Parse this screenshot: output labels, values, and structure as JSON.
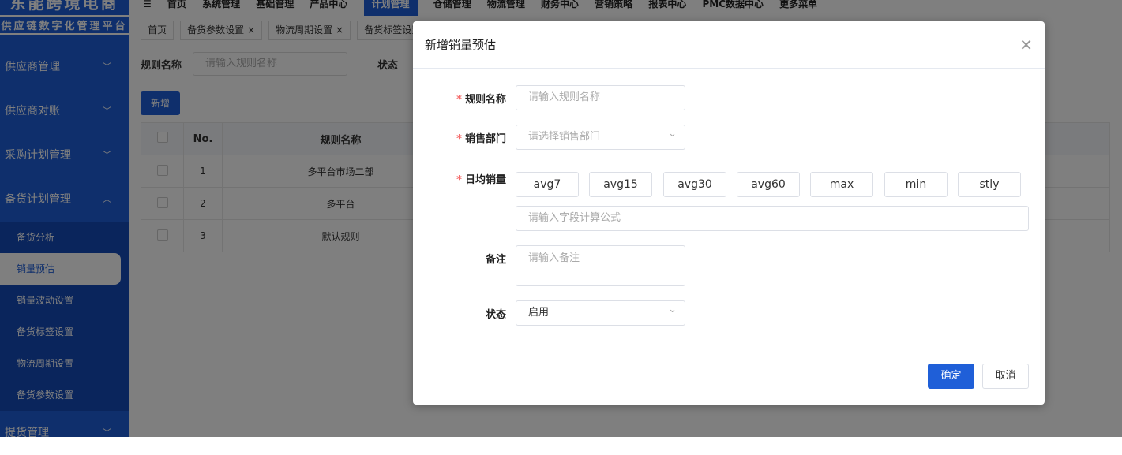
{
  "logo": {
    "line1": "东能跨境电商",
    "line2": "供应链数字化管理平台"
  },
  "topnav": [
    "首页",
    "系统管理",
    "基础管理",
    "产品中心",
    "计划管理",
    "仓储管理",
    "物流管理",
    "财务中心",
    "营销策略",
    "报表中心",
    "PMC数据中心",
    "更多菜单"
  ],
  "tabs": [
    "首页",
    "备货参数设置 ×",
    "物流周期设置 ×",
    "备货标签设置"
  ],
  "sidebar": {
    "items": [
      {
        "label": "供应商管理"
      },
      {
        "label": "供应商对账"
      },
      {
        "label": "采购计划管理"
      },
      {
        "label": "备货计划管理"
      }
    ],
    "sub": [
      "备货分析",
      "销量预估",
      "销量波动设置",
      "备货标签设置",
      "物流周期设置",
      "备货参数设置"
    ],
    "last": "提货管理"
  },
  "filter": {
    "name_label": "规则名称",
    "name_placeholder": "请输入规则名称",
    "status_label": "状态"
  },
  "new_button": "新增",
  "table": {
    "headers": [
      "No.",
      "规则名称"
    ],
    "rows": [
      [
        "1",
        "多平台市场二部"
      ],
      [
        "2",
        "多平台"
      ],
      [
        "3",
        "默认规则"
      ]
    ]
  },
  "dialog": {
    "title": "新增销量预估",
    "fields": {
      "name_label": "规则名称",
      "name_placeholder": "请输入规则名称",
      "dept_label": "销售部门",
      "dept_placeholder": "请选择销售部门",
      "avg_label": "日均销量",
      "chips": [
        "avg7",
        "avg15",
        "avg30",
        "avg60",
        "max",
        "min",
        "stly"
      ],
      "formula_placeholder": "请输入字段计算公式",
      "remark_label": "备注",
      "remark_placeholder": "请输入备注",
      "status_label": "状态",
      "status_value": "启用"
    },
    "confirm": "确定",
    "cancel": "取消"
  },
  "colors": {
    "primary": "#1f5fd8",
    "required": "#f56c6c"
  }
}
